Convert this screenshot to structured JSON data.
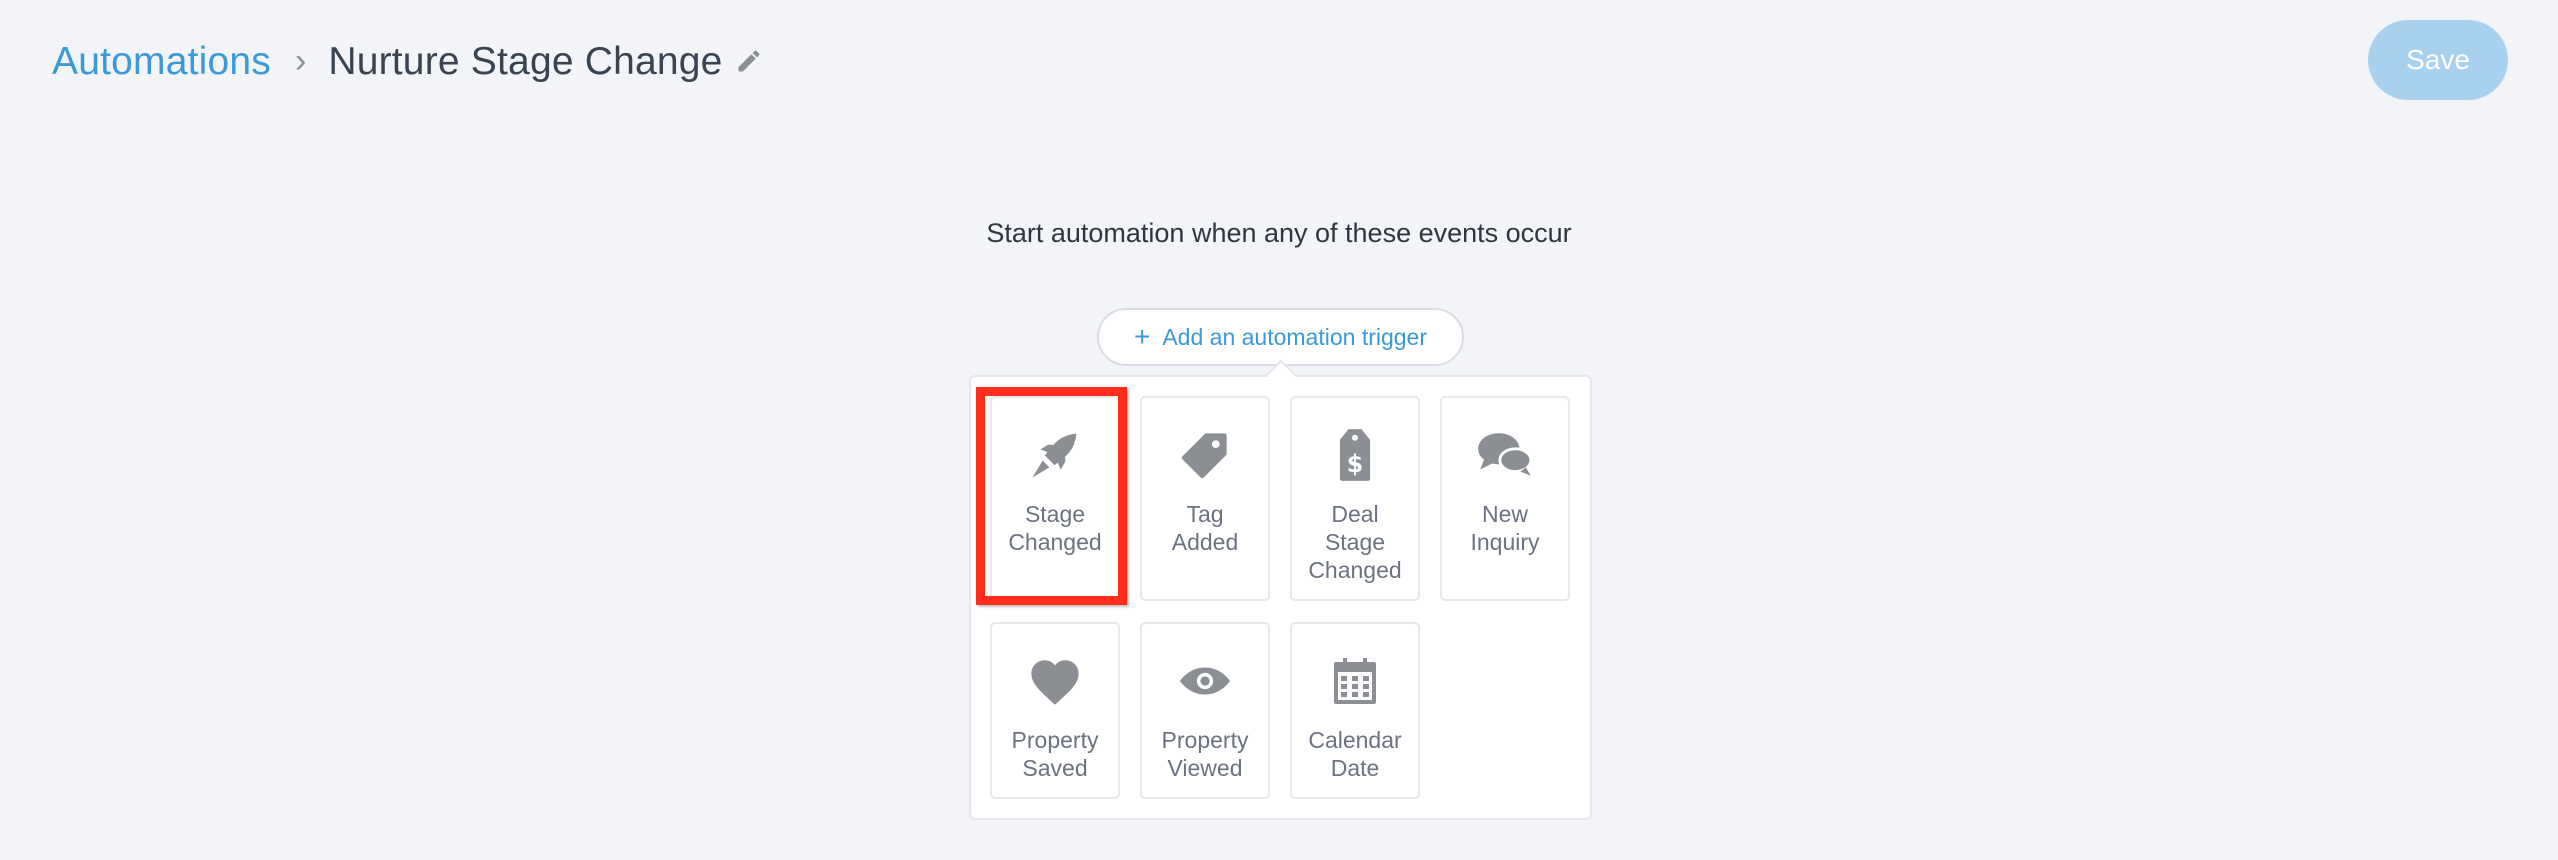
{
  "header": {
    "breadcrumb_root": "Automations",
    "separator": "›",
    "title": "Nurture Stage Change",
    "save_label": "Save"
  },
  "main": {
    "instruction": "Start automation when any of these events occur",
    "add_trigger_label": "Add an automation trigger",
    "add_trigger_icon": "+"
  },
  "triggers": [
    {
      "label": "Stage\nChanged",
      "icon": "rocket-icon",
      "selected": true
    },
    {
      "label": "Tag\nAdded",
      "icon": "tag-icon"
    },
    {
      "label": "Deal\nStage\nChanged",
      "icon": "price-tag-dollar-icon"
    },
    {
      "label": "New\nInquiry",
      "icon": "chat-bubbles-icon"
    },
    {
      "label": "Property\nSaved",
      "icon": "heart-icon"
    },
    {
      "label": "Property\nViewed",
      "icon": "eye-icon"
    },
    {
      "label": "Calendar\nDate",
      "icon": "calendar-icon"
    }
  ],
  "colors": {
    "accent": "#3a9ad9",
    "save_disabled": "#a7d1ef",
    "icon_gray": "#8b8f94",
    "highlight": "#ff2d1a",
    "background": "#f2f4f8"
  }
}
